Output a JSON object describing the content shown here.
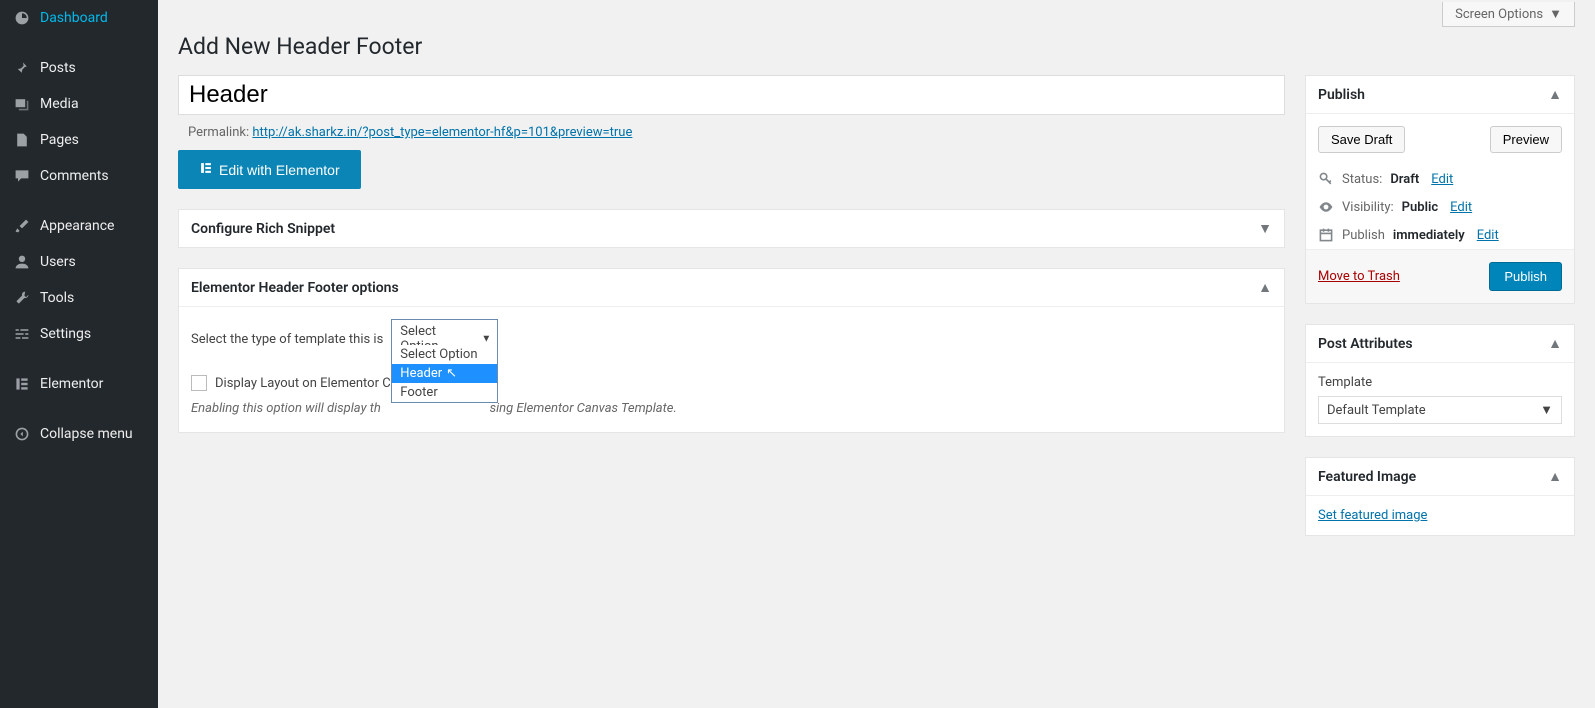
{
  "topbar": {
    "screen_options": "Screen Options"
  },
  "sidebar": {
    "items": [
      {
        "label": "Dashboard",
        "icon": "dashboard"
      },
      {
        "label": "Posts",
        "icon": "pin"
      },
      {
        "label": "Media",
        "icon": "media"
      },
      {
        "label": "Pages",
        "icon": "pages"
      },
      {
        "label": "Comments",
        "icon": "comment"
      },
      {
        "label": "Appearance",
        "icon": "brush"
      },
      {
        "label": "Users",
        "icon": "user"
      },
      {
        "label": "Tools",
        "icon": "wrench"
      },
      {
        "label": "Settings",
        "icon": "sliders"
      },
      {
        "label": "Elementor",
        "icon": "elementor"
      },
      {
        "label": "Collapse menu",
        "icon": "collapse"
      }
    ]
  },
  "page": {
    "title": "Add New Header Footer",
    "post_title": "Header",
    "permalink_label": "Permalink:",
    "permalink": "http://ak.sharkz.in/?post_type=elementor-hf&p=101&preview=true",
    "edit_elementor": "Edit with Elementor"
  },
  "meta_rich": {
    "title": "Configure Rich Snippet"
  },
  "meta_hf": {
    "title": "Elementor Header Footer options",
    "type_label": "Select the type of template this is",
    "type_selected": "Select Option",
    "type_options": [
      "Select Option",
      "Header",
      "Footer"
    ],
    "display_label": "Display Layout on Elementor Canvas Template?",
    "display_label_clipped": "Display Layout on Elementor C",
    "hint_full": "Enabling this option will display the layout on pages using Elementor Canvas Template.",
    "hint_prefix": "Enabling this option will display th",
    "hint_suffix": "sing Elementor Canvas Template."
  },
  "publish": {
    "box_title": "Publish",
    "save_draft": "Save Draft",
    "preview": "Preview",
    "status_label": "Status:",
    "status_value": "Draft",
    "visibility_label": "Visibility:",
    "visibility_value": "Public",
    "schedule_label": "Publish",
    "schedule_value": "immediately",
    "edit": "Edit",
    "trash": "Move to Trash",
    "publish_btn": "Publish"
  },
  "attributes": {
    "box_title": "Post Attributes",
    "template_label": "Template",
    "template_value": "Default Template"
  },
  "featured": {
    "box_title": "Featured Image",
    "link": "Set featured image"
  }
}
